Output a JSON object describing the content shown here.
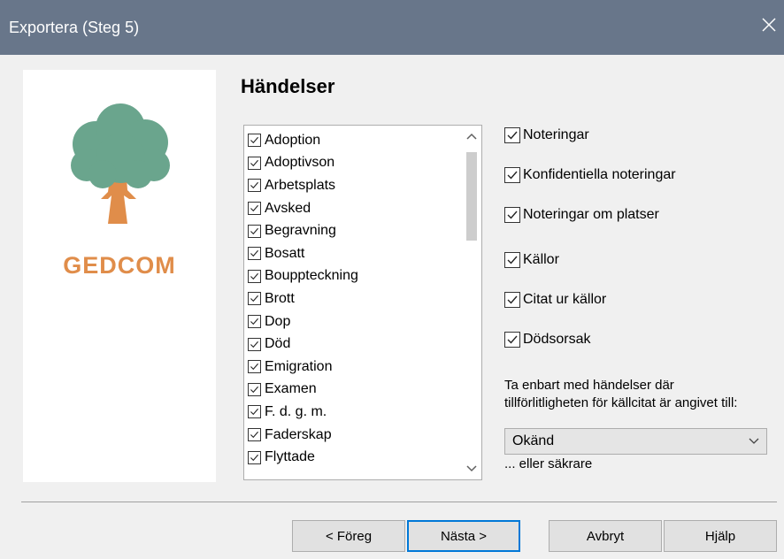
{
  "window": {
    "title": "Exportera (Steg 5)"
  },
  "logo": {
    "text": "GEDCOM",
    "text_color": "#e08d4a",
    "foliage_color": "#6aa58d",
    "trunk_color": "#e08d4a"
  },
  "events": {
    "heading": "Händelser",
    "items": [
      {
        "label": "Adoption",
        "checked": true
      },
      {
        "label": "Adoptivson",
        "checked": true
      },
      {
        "label": "Arbetsplats",
        "checked": true
      },
      {
        "label": "Avsked",
        "checked": true
      },
      {
        "label": "Begravning",
        "checked": true
      },
      {
        "label": "Bosatt",
        "checked": true
      },
      {
        "label": "Bouppteckning",
        "checked": true
      },
      {
        "label": "Brott",
        "checked": true
      },
      {
        "label": "Dop",
        "checked": true
      },
      {
        "label": "Död",
        "checked": true
      },
      {
        "label": "Emigration",
        "checked": true
      },
      {
        "label": "Examen",
        "checked": true
      },
      {
        "label": "F. d. g. m.",
        "checked": true
      },
      {
        "label": "Faderskap",
        "checked": true
      },
      {
        "label": "Flyttade",
        "checked": true
      }
    ]
  },
  "options": [
    {
      "label": "Noteringar",
      "checked": true
    },
    {
      "label": "Konfidentiella noteringar",
      "checked": true
    },
    {
      "label": "Noteringar om platser",
      "checked": true
    },
    {
      "label": "Källor",
      "checked": true
    },
    {
      "label": "Citat ur källor",
      "checked": true
    },
    {
      "label": "Dödsorsak",
      "checked": true
    }
  ],
  "reliability": {
    "label_line1": "Ta enbart med händelser där",
    "label_line2": "tillförlitligheten för källcitat är angivet till:",
    "selected": "Okänd",
    "suffix": "... eller säkrare"
  },
  "buttons": {
    "back": "< Föreg",
    "next": "Nästa >",
    "cancel": "Avbryt",
    "help": "Hjälp"
  }
}
